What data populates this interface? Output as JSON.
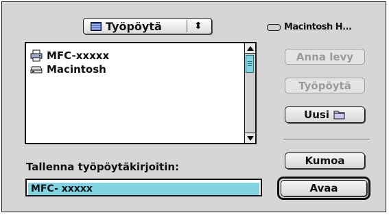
{
  "location_popup": {
    "label": "Työpöytä",
    "icon": "desktop-icon",
    "arrows": "⬍"
  },
  "volume": {
    "label": "Macintosh H...",
    "icon": "drive-icon"
  },
  "file_list": {
    "items": [
      {
        "label": "MFC-xxxxx",
        "icon": "printer-icon"
      },
      {
        "label": "Macintosh",
        "icon": "hard-drive-icon"
      }
    ]
  },
  "buttons": {
    "eject": "Anna levy",
    "desktop": "Työpöytä",
    "new": "Uusi",
    "new_icon": "folder-icon",
    "cancel": "Kumoa",
    "open": "Avaa"
  },
  "save": {
    "label": "Tallenna työpöytäkirjoitin:",
    "value": "MFC- xxxxx"
  },
  "colors": {
    "selection": "#7fd3e3",
    "window": "#d6d6d6"
  }
}
